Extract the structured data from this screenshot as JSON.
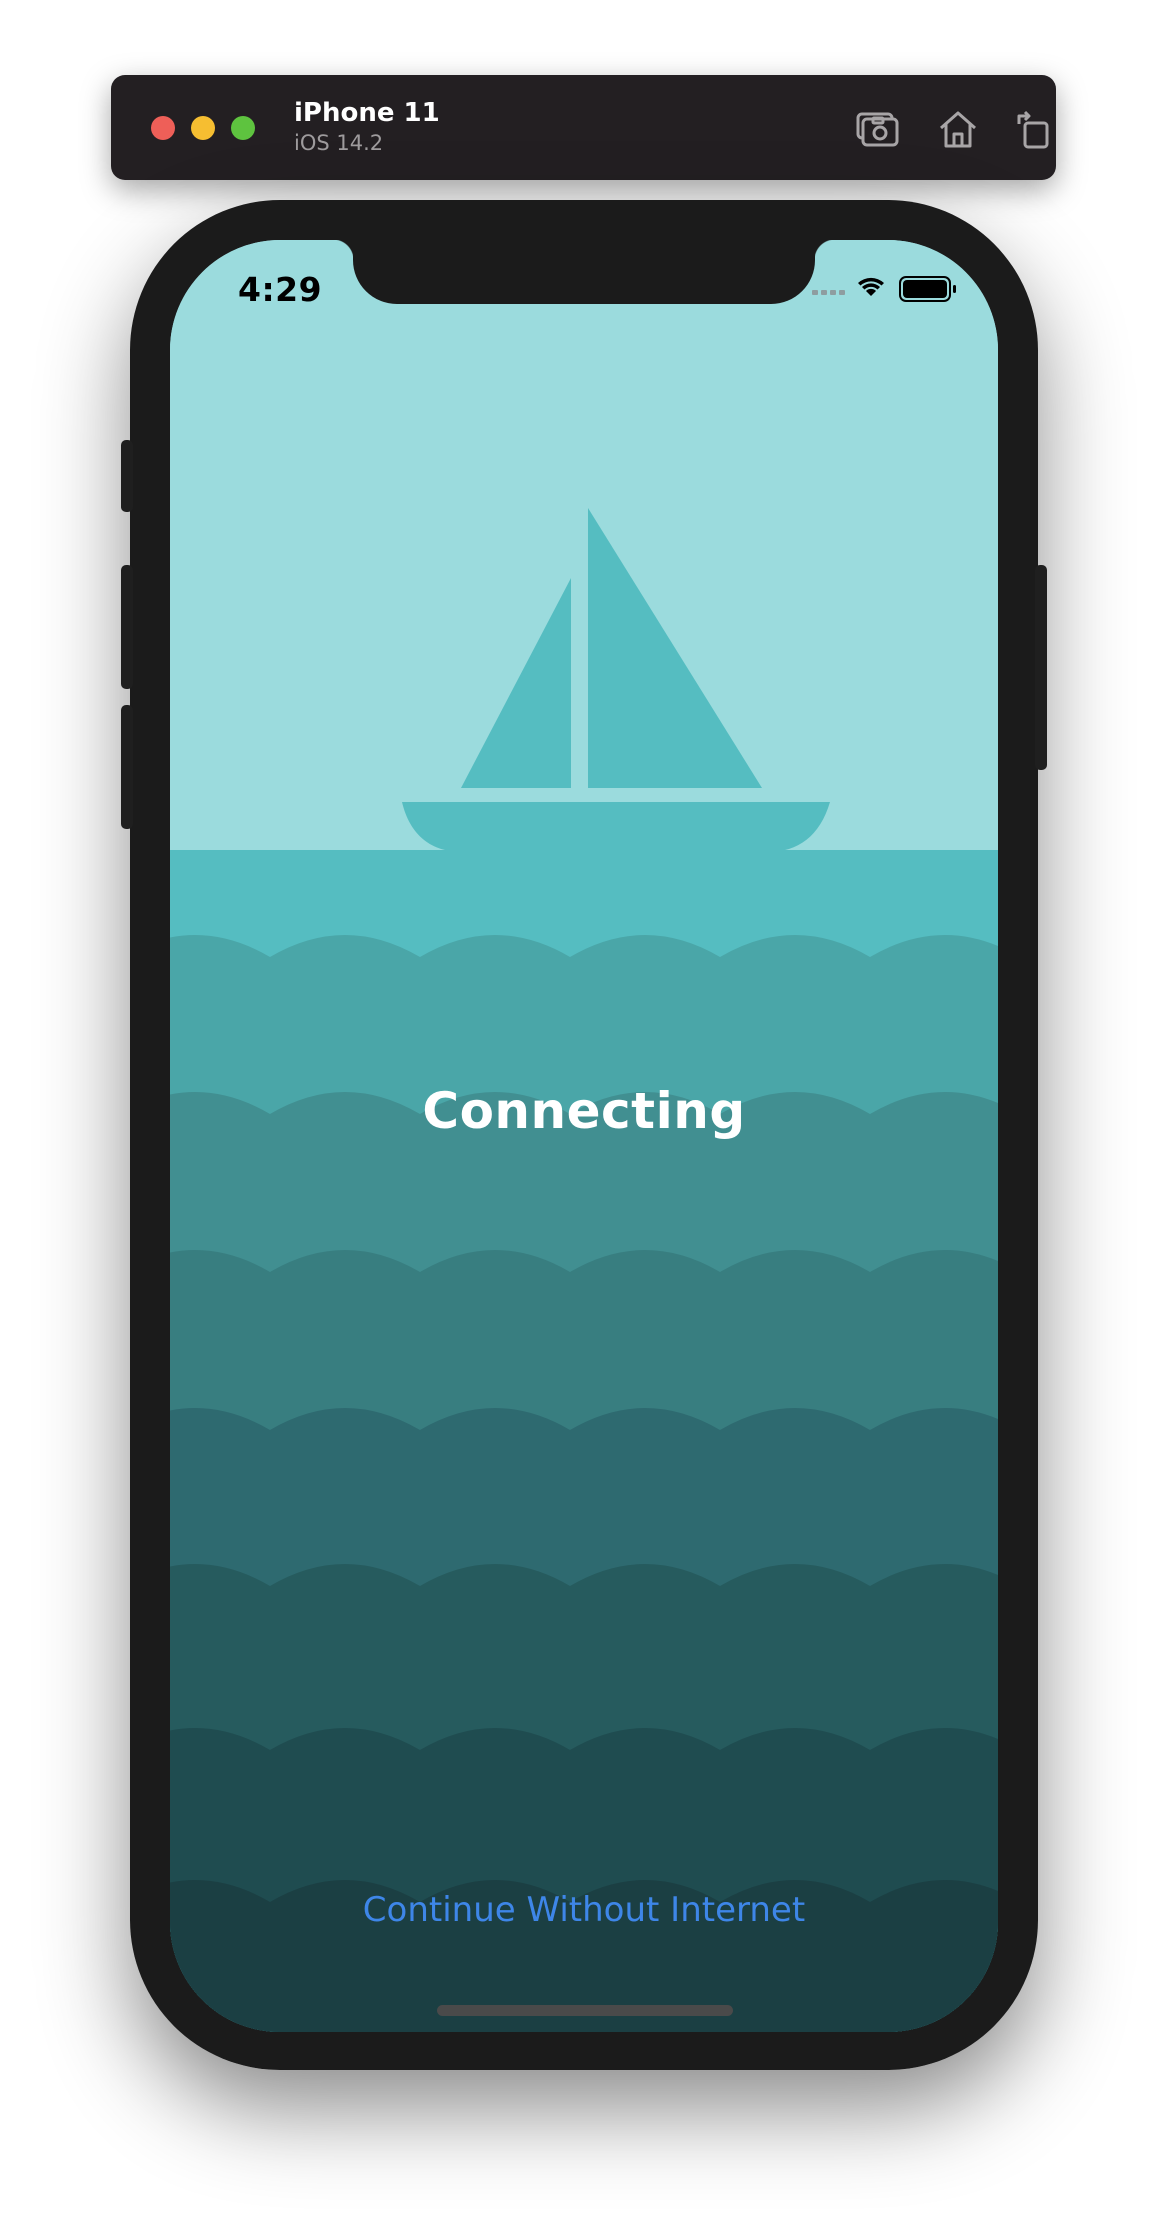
{
  "simulator": {
    "device_name": "iPhone 11",
    "os_version": "iOS 14.2",
    "toolbar_icons": [
      "screenshot-icon",
      "home-icon",
      "rotate-icon"
    ]
  },
  "status_bar": {
    "time": "4:29",
    "icons": [
      "cellular-signal-icon",
      "wifi-icon",
      "battery-icon"
    ]
  },
  "app": {
    "status_text": "Connecting",
    "continue_label": "Continue Without Internet"
  },
  "colors": {
    "sky": "#9bdbdd",
    "sea_top": "#55bdc1",
    "accent_link": "#3e86e8",
    "wave_bands": [
      "#4aa6a8",
      "#418f91",
      "#387e80",
      "#2e6a70",
      "#265b5e",
      "#1f4c50",
      "#1b3f43"
    ]
  }
}
